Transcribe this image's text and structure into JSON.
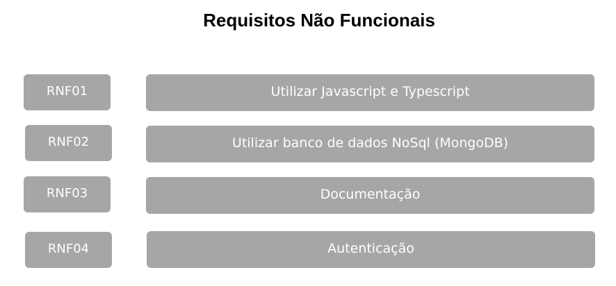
{
  "title": "Requisitos Não Funcionais",
  "requirements": [
    {
      "code": "RNF01",
      "description": "Utilizar Javascript e Typescript"
    },
    {
      "code": "RNF02",
      "description": "Utilizar banco de dados NoSql (MongoDB)"
    },
    {
      "code": "RNF03",
      "description": "Documentação"
    },
    {
      "code": "RNF04",
      "description": "Autenticação"
    }
  ],
  "colors": {
    "box_fill": "#a6a6a6",
    "box_text": "#ffffff",
    "title_text": "#000000",
    "background": "#ffffff"
  }
}
